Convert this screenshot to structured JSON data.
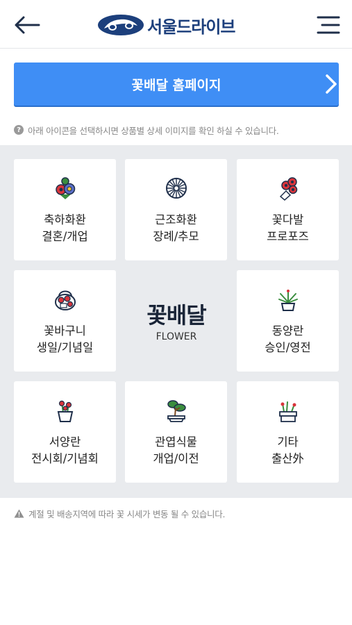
{
  "header": {
    "back_icon": "arrow-left-icon",
    "logo_text": "서울드라이브",
    "menu_icon": "hamburger-menu-icon"
  },
  "cta": {
    "label": "꽃배달 홈페이지",
    "icon": "chevron-right-icon"
  },
  "notice": {
    "icon": "question-icon",
    "text": "아래 아이콘을 선택하시면 상품별 상세 이미지를 확인 하실 수 있습니다."
  },
  "categories": [
    {
      "icon": "flower-wreath-icon",
      "line1": "축하화환",
      "line2": "결혼/개업"
    },
    {
      "icon": "chrysanthemum-icon",
      "line1": "근조화환",
      "line2": "장례/추모"
    },
    {
      "icon": "bouquet-icon",
      "line1": "꽃다발",
      "line2": "프로포즈"
    },
    {
      "icon": "flower-basket-icon",
      "line1": "꽃바구니",
      "line2": "생일/기념일"
    },
    {
      "icon": "orchid-pot-icon",
      "line1": "동양란",
      "line2": "승인/영전"
    },
    {
      "icon": "western-orchid-icon",
      "line1": "서양란",
      "line2": "전시회/기념회"
    },
    {
      "icon": "bonsai-icon",
      "line1": "관엽식물",
      "line2": "개업/이전"
    },
    {
      "icon": "gift-plant-icon",
      "line1": "기타",
      "line2": "출산外"
    }
  ],
  "center": {
    "title": "꽃배달",
    "subtitle": "FLOWER"
  },
  "warning": {
    "icon": "warning-triangle-icon",
    "text": "계절 및 배송지역에 따라 꽃 시세가 변동 될 수 있습니다."
  },
  "colors": {
    "accent": "#3f8ef5",
    "brand": "#1c3f7c",
    "grid_bg": "#e9ebee"
  }
}
